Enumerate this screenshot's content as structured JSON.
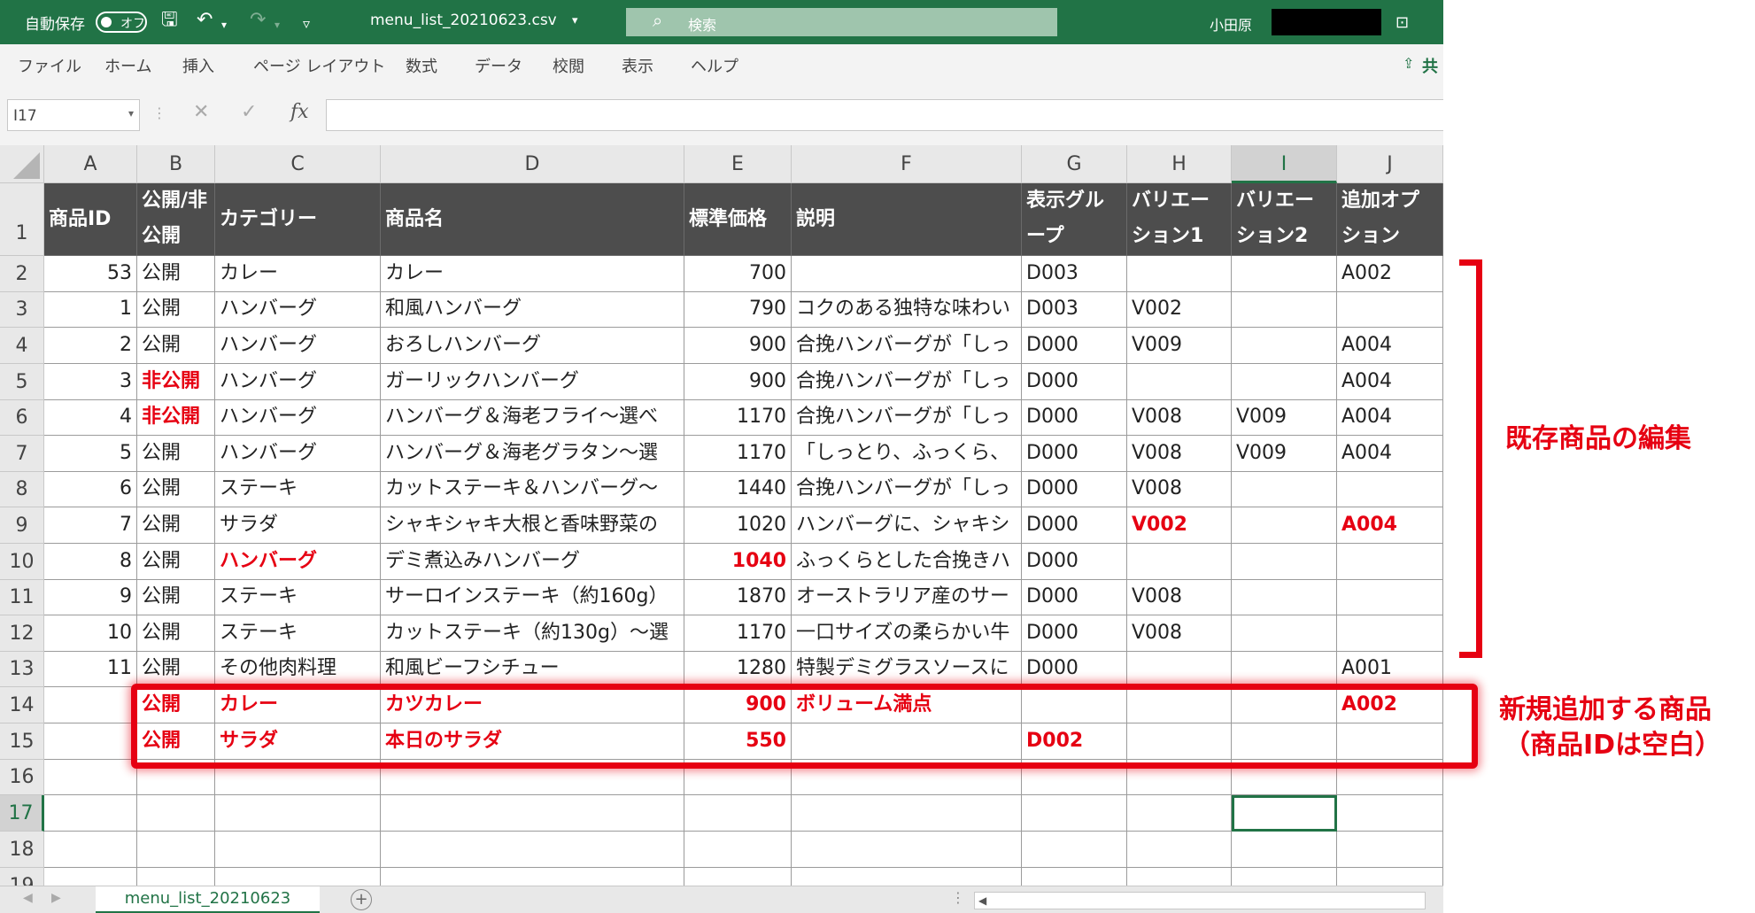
{
  "titlebar": {
    "autosave_label": "自動保存",
    "autosave_state": "オフ",
    "filename": "menu_list_20210623.csv",
    "filename_dropdown": "▾",
    "search_placeholder": "検索",
    "user_name": "小田原"
  },
  "ribbon_tabs": [
    "ファイル",
    "ホーム",
    "挿入",
    "ページ レイアウト",
    "数式",
    "データ",
    "校閲",
    "表示",
    "ヘルプ"
  ],
  "share_label": "共",
  "formula_bar": {
    "name_box": "I17",
    "formula": ""
  },
  "columns": [
    "A",
    "B",
    "C",
    "D",
    "E",
    "F",
    "G",
    "H",
    "I",
    "J"
  ],
  "selected_column": "I",
  "selected_row": 17,
  "header_row": [
    "商品ID",
    "公開/非公開",
    "カテゴリー",
    "商品名",
    "標準価格",
    "説明",
    "表示グループ",
    "バリエーション1",
    "バリエーション2",
    "追加オプション"
  ],
  "rows": [
    {
      "n": 2,
      "cells": [
        "53",
        "公開",
        "カレー",
        "カレー",
        "700",
        "",
        "D003",
        "",
        "",
        "A002"
      ]
    },
    {
      "n": 3,
      "cells": [
        "1",
        "公開",
        "ハンバーグ",
        "和風ハンバーグ",
        "790",
        "コクのある独特な味わい",
        "D003",
        "V002",
        "",
        ""
      ]
    },
    {
      "n": 4,
      "cells": [
        "2",
        "公開",
        "ハンバーグ",
        "おろしハンバーグ",
        "900",
        "合挽ハンバーグが「しっ",
        "D000",
        "V009",
        "",
        "A004"
      ]
    },
    {
      "n": 5,
      "cells": [
        "3",
        "非公開",
        "ハンバーグ",
        "ガーリックハンバーグ",
        "900",
        "合挽ハンバーグが「しっ",
        "D000",
        "",
        "",
        "A004"
      ]
    },
    {
      "n": 6,
      "cells": [
        "4",
        "非公開",
        "ハンバーグ",
        "ハンバーグ＆海老フライ～選べ",
        "1170",
        "合挽ハンバーグが「しっ",
        "D000",
        "V008",
        "V009",
        "A004"
      ]
    },
    {
      "n": 7,
      "cells": [
        "5",
        "公開",
        "ハンバーグ",
        "ハンバーグ＆海老グラタン～選",
        "1170",
        "「しっとり、ふっくら、",
        "D000",
        "V008",
        "V009",
        "A004"
      ]
    },
    {
      "n": 8,
      "cells": [
        "6",
        "公開",
        "ステーキ",
        "カットステーキ＆ハンバーグ～",
        "1440",
        "合挽ハンバーグが「しっ",
        "D000",
        "V008",
        "",
        ""
      ]
    },
    {
      "n": 9,
      "cells": [
        "7",
        "公開",
        "サラダ",
        "シャキシャキ大根と香味野菜の",
        "1020",
        "ハンバーグに、シャキシ",
        "D000",
        "V002",
        "",
        "A004"
      ]
    },
    {
      "n": 10,
      "cells": [
        "8",
        "公開",
        "ハンバーグ",
        "デミ煮込みハンバーグ",
        "1040",
        "ふっくらとした合挽きハ",
        "D000",
        "",
        "",
        ""
      ]
    },
    {
      "n": 11,
      "cells": [
        "9",
        "公開",
        "ステーキ",
        "サーロインステーキ（約160g）",
        "1870",
        "オーストラリア産のサー",
        "D000",
        "V008",
        "",
        ""
      ]
    },
    {
      "n": 12,
      "cells": [
        "10",
        "公開",
        "ステーキ",
        "カットステーキ（約130g）～選",
        "1170",
        "一口サイズの柔らかい牛",
        "D000",
        "V008",
        "",
        ""
      ]
    },
    {
      "n": 13,
      "cells": [
        "11",
        "公開",
        "その他肉料理",
        "和風ビーフシチュー",
        "1280",
        "特製デミグラスソースに",
        "D000",
        "",
        "",
        "A001"
      ]
    },
    {
      "n": 14,
      "cells": [
        "",
        "公開",
        "カレー",
        "カツカレー",
        "900",
        "ボリューム満点",
        "",
        "",
        "",
        "A002"
      ]
    },
    {
      "n": 15,
      "cells": [
        "",
        "公開",
        "サラダ",
        "本日のサラダ",
        "550",
        "",
        "D002",
        "",
        "",
        ""
      ]
    },
    {
      "n": 16,
      "cells": [
        "",
        "",
        "",
        "",
        "",
        "",
        "",
        "",
        "",
        ""
      ]
    },
    {
      "n": 17,
      "cells": [
        "",
        "",
        "",
        "",
        "",
        "",
        "",
        "",
        "",
        ""
      ]
    },
    {
      "n": 18,
      "cells": [
        "",
        "",
        "",
        "",
        "",
        "",
        "",
        "",
        "",
        ""
      ]
    },
    {
      "n": 19,
      "cells": [
        "",
        "",
        "",
        "",
        "",
        "",
        "",
        "",
        "",
        ""
      ]
    }
  ],
  "highlight_red": [
    [
      5,
      1
    ],
    [
      6,
      1
    ],
    [
      9,
      7
    ],
    [
      9,
      9
    ],
    [
      10,
      2
    ],
    [
      10,
      4
    ],
    [
      14,
      1
    ],
    [
      14,
      2
    ],
    [
      14,
      3
    ],
    [
      14,
      4
    ],
    [
      14,
      5
    ],
    [
      14,
      9
    ],
    [
      15,
      1
    ],
    [
      15,
      2
    ],
    [
      15,
      3
    ],
    [
      15,
      4
    ],
    [
      15,
      6
    ]
  ],
  "sheet_tab": "menu_list_20210623",
  "annotations": {
    "existing_label": "既存商品の編集",
    "new_label_line1": "新規追加する商品",
    "new_label_line2": "（商品IDは空白）"
  },
  "colors": {
    "excel_green": "#217346",
    "annotation_red": "#e60012",
    "header_fill": "#4d4d4d"
  }
}
